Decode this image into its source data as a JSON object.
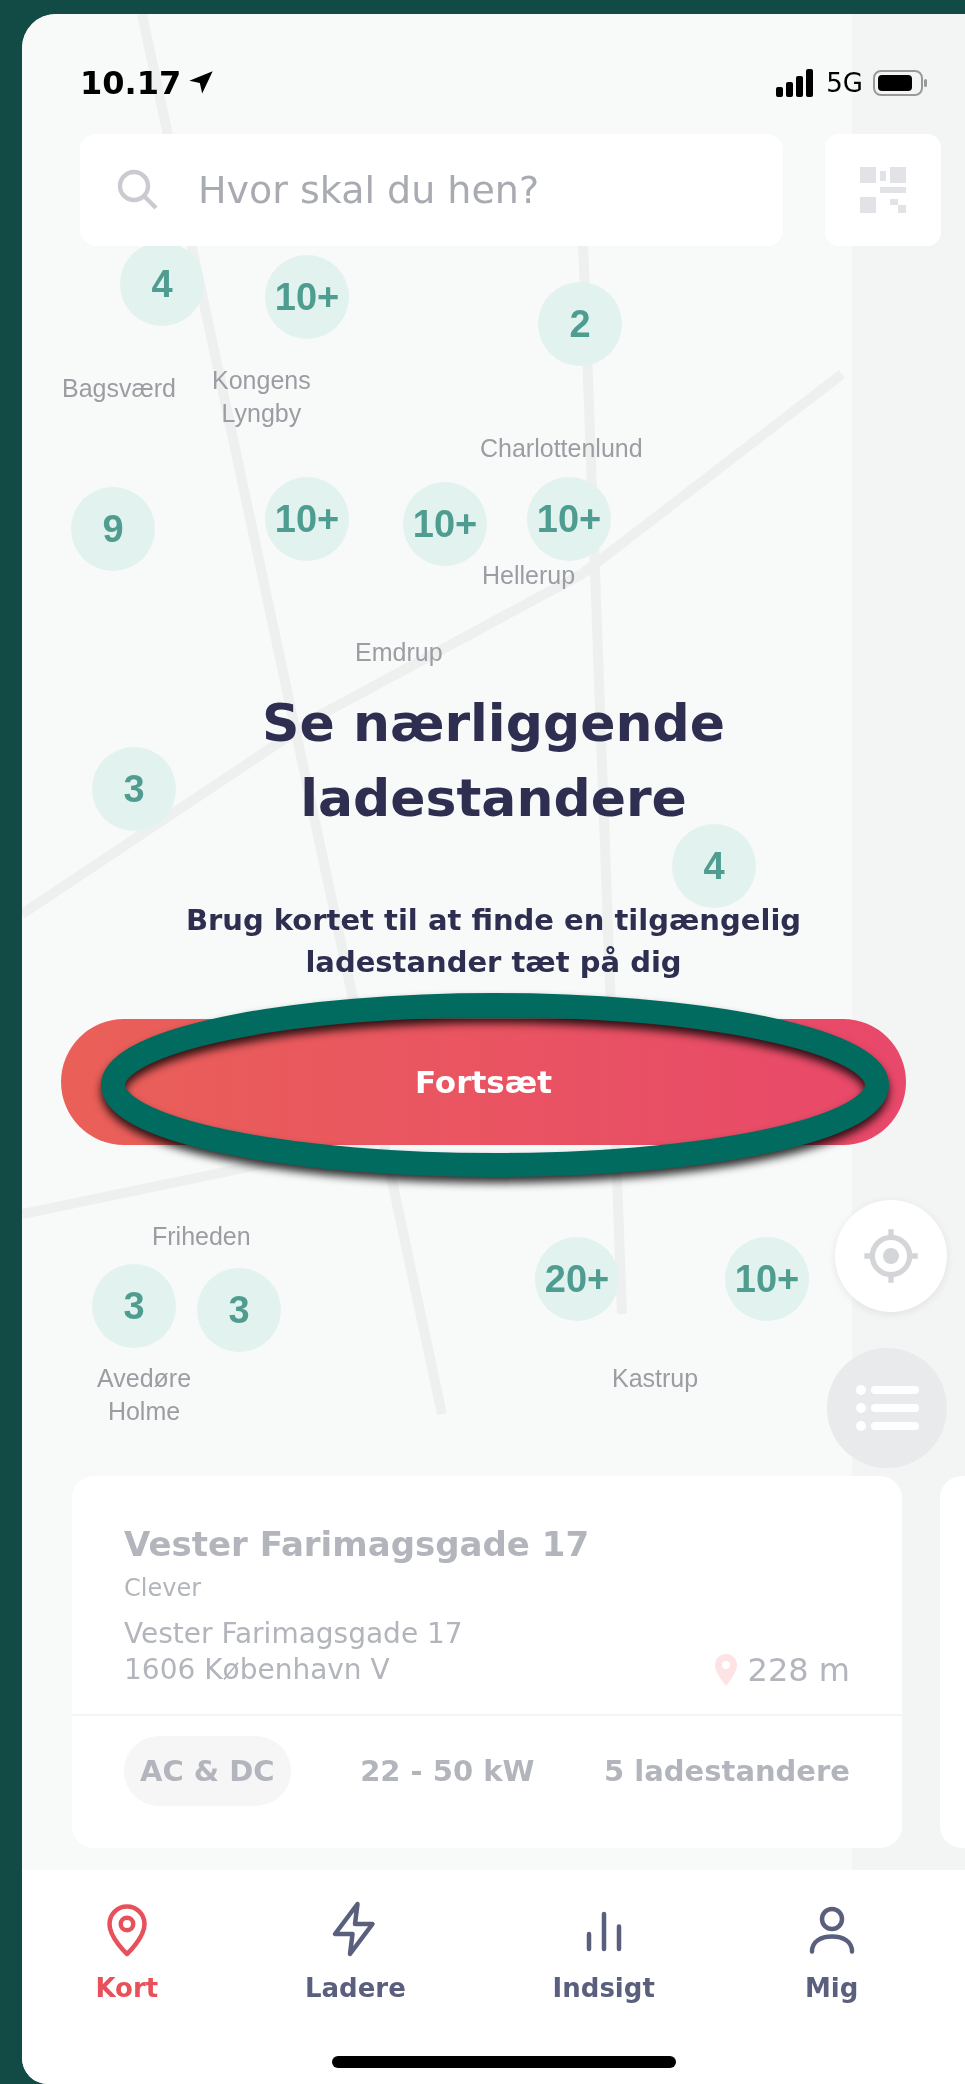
{
  "status_bar": {
    "time": "10.17",
    "network": "5G"
  },
  "search": {
    "placeholder": "Hvor skal du hen?"
  },
  "map": {
    "places": [
      {
        "name": "Bagsværd"
      },
      {
        "name": "Kongens\nLyngby"
      },
      {
        "name": "Charlottenlund"
      },
      {
        "name": "Hellerup"
      },
      {
        "name": "Emdrup"
      },
      {
        "name": "Friheden"
      },
      {
        "name": "Avedøre\nHolme"
      },
      {
        "name": "Kastrup"
      }
    ],
    "clusters": [
      {
        "count": "4"
      },
      {
        "count": "10+"
      },
      {
        "count": "2"
      },
      {
        "count": "9"
      },
      {
        "count": "10+"
      },
      {
        "count": "10+"
      },
      {
        "count": "10+"
      },
      {
        "count": "3"
      },
      {
        "count": "4"
      },
      {
        "count": "3"
      },
      {
        "count": "3"
      },
      {
        "count": "20+"
      },
      {
        "count": "10+"
      }
    ]
  },
  "prompt": {
    "title": "Se nærliggende ladestandere",
    "text": "Brug kortet til at finde en tilgængelig ladestander tæt på dig",
    "button": "Fortsæt"
  },
  "station_card": {
    "name": "Vester Farimagsgade 17",
    "operator": "Clever",
    "address_line_1": "Vester Farimagsgade 17",
    "address_line_2": "1606 København V",
    "distance": "228 m",
    "plug_type": "AC & DC",
    "power": "22 - 50 kW",
    "charger_count": "5 ladestandere"
  },
  "tabs": [
    {
      "label": "Kort",
      "selected": true
    },
    {
      "label": "Ladere",
      "selected": false
    },
    {
      "label": "Indsigt",
      "selected": false
    },
    {
      "label": "Mig",
      "selected": false
    }
  ]
}
